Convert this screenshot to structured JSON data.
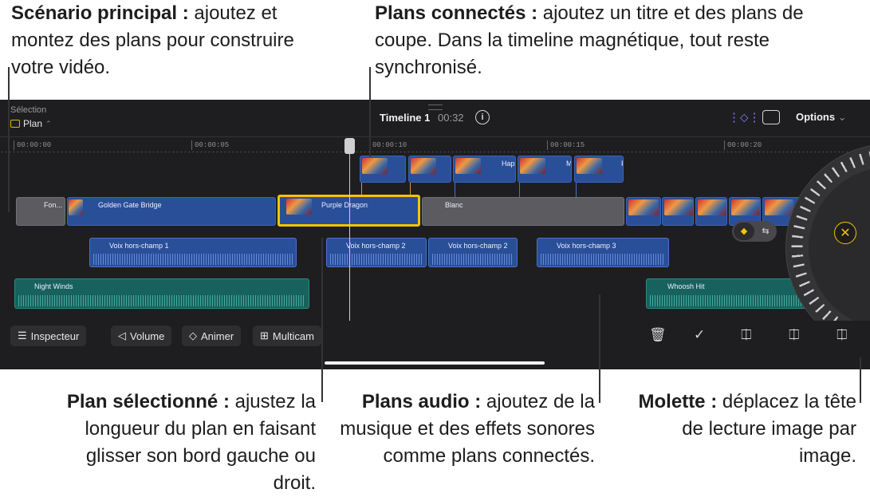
{
  "callouts": {
    "left": {
      "title": "Scénario principal :",
      "text": " ajoutez et montez des plans pour construire votre vidéo."
    },
    "top": {
      "title": "Plans connectés :",
      "text": " ajoutez un titre et des plans de coupe. Dans la timeline magnétique, tout reste synchronisé."
    },
    "selected": {
      "title": "Plan sélectionné :",
      "text": " ajustez la longueur du plan en faisant glisser son bord gauche ou droit."
    },
    "audio": {
      "title": "Plans audio :",
      "text": " ajoutez de la musique et des effets sonores comme plans connectés."
    },
    "wheel": {
      "title": "Molette :",
      "text": " déplacez la tête de lecture image par image."
    }
  },
  "header": {
    "selection_label": "Sélection",
    "selection_value": "Plan",
    "timeline_title": "Timeline 1",
    "duration": "00:32",
    "options_label": "Options"
  },
  "ruler": [
    "00:00:00",
    "00:00:05",
    "00:00:10",
    "00:00:15",
    "00:00:20"
  ],
  "clips": {
    "connected": [
      "",
      "",
      "Hap",
      "M",
      "F"
    ],
    "fond": "Fon...",
    "golden_gate": "Golden Gate Bridge",
    "purple_dragon": "Purple Dragon",
    "blanc": "Blanc",
    "voix1": "Voix hors-champ 1",
    "voix2a": "Voix hors-champ 2",
    "voix2b": "Voix hors-champ 2",
    "voix3": "Voix hors-champ 3",
    "night_winds": "Night Winds",
    "whoosh": "Whoosh Hit"
  },
  "toolbar": {
    "inspector": "Inspecteur",
    "volume": "Volume",
    "animate": "Animer",
    "multicam": "Multicam"
  },
  "colors": {
    "accent": "#f4c400",
    "clip_blue": "#2a4f99",
    "audio_teal": "#17625d",
    "snap": "#7f7cff"
  }
}
